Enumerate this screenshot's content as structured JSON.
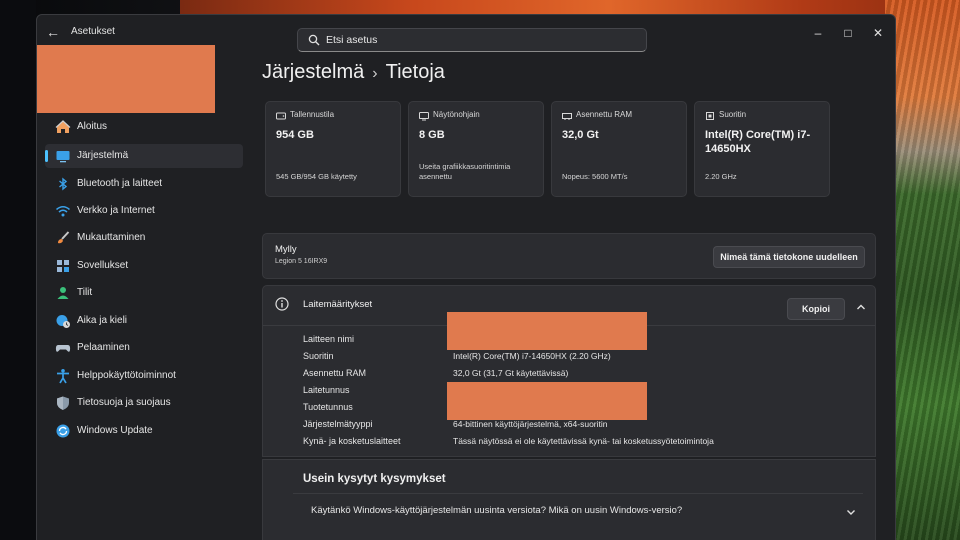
{
  "window": {
    "app_title": "Asetukset",
    "search_placeholder": "Etsi asetus"
  },
  "sidebar": {
    "items": [
      {
        "label": "Aloitus",
        "icon": "home-icon",
        "active": false
      },
      {
        "label": "Järjestelmä",
        "icon": "system-icon",
        "active": true
      },
      {
        "label": "Bluetooth ja laitteet",
        "icon": "bluetooth-icon",
        "active": false
      },
      {
        "label": "Verkko ja Internet",
        "icon": "wifi-icon",
        "active": false
      },
      {
        "label": "Mukauttaminen",
        "icon": "brush-icon",
        "active": false
      },
      {
        "label": "Sovellukset",
        "icon": "apps-icon",
        "active": false
      },
      {
        "label": "Tilit",
        "icon": "account-icon",
        "active": false
      },
      {
        "label": "Aika ja kieli",
        "icon": "globe-clock-icon",
        "active": false
      },
      {
        "label": "Pelaaminen",
        "icon": "gamepad-icon",
        "active": false
      },
      {
        "label": "Helppokäyttötoiminnot",
        "icon": "accessibility-icon",
        "active": false
      },
      {
        "label": "Tietosuoja ja suojaus",
        "icon": "shield-icon",
        "active": false
      },
      {
        "label": "Windows Update",
        "icon": "update-icon",
        "active": false
      }
    ]
  },
  "breadcrumb": {
    "parent": "Järjestelmä",
    "separator": "›",
    "current": "Tietoja"
  },
  "cards": {
    "storage": {
      "label": "Tallennustila",
      "value": "954 GB",
      "sub": "545 GB/954 GB käytetty"
    },
    "gpu": {
      "label": "Näytönohjain",
      "value": "8 GB",
      "sub": "Useita grafiikkasuoritintimia asennettu"
    },
    "ram": {
      "label": "Asennettu RAM",
      "value": "32,0 Gt",
      "sub": "Nopeus: 5600 MT/s"
    },
    "cpu": {
      "label": "Suoritin",
      "value": "Intel(R) Core(TM) i7-14650HX",
      "sub": "2.20 GHz"
    }
  },
  "device": {
    "name": "Mylly",
    "model": "Legion 5 16IRX9",
    "rename_label": "Nimeä tämä tietokone uudelleen"
  },
  "specs": {
    "title": "Laitemääritykset",
    "copy_label": "Kopioi",
    "rows": [
      {
        "key": "Laitteen nimi",
        "value": ""
      },
      {
        "key": "Suoritin",
        "value": "Intel(R) Core(TM) i7-14650HX (2.20 GHz)"
      },
      {
        "key": "Asennettu RAM",
        "value": "32,0 Gt (31,7 Gt käytettävissä)"
      },
      {
        "key": "Laitetunnus",
        "value": ""
      },
      {
        "key": "Tuotetunnus",
        "value": ""
      },
      {
        "key": "Järjestelmätyyppi",
        "value": "64-bittinen käyttöjärjestelmä, x64-suoritin"
      },
      {
        "key": "Kynä- ja kosketuslaitteet",
        "value": "Tässä näytössä ei ole käytettävissä kynä- tai kosketussyötetoimintoja"
      }
    ]
  },
  "faq": {
    "title": "Usein kysytyt kysymykset",
    "q1": "Käytänkö Windows-käyttöjärjestelmän uusinta versiota? Mikä on uusin Windows-versio?"
  },
  "colors": {
    "accent": "#4cc2ff",
    "redaction": "#e07a4e",
    "window_bg": "#1f2023",
    "card_bg": "#2b2c30"
  }
}
